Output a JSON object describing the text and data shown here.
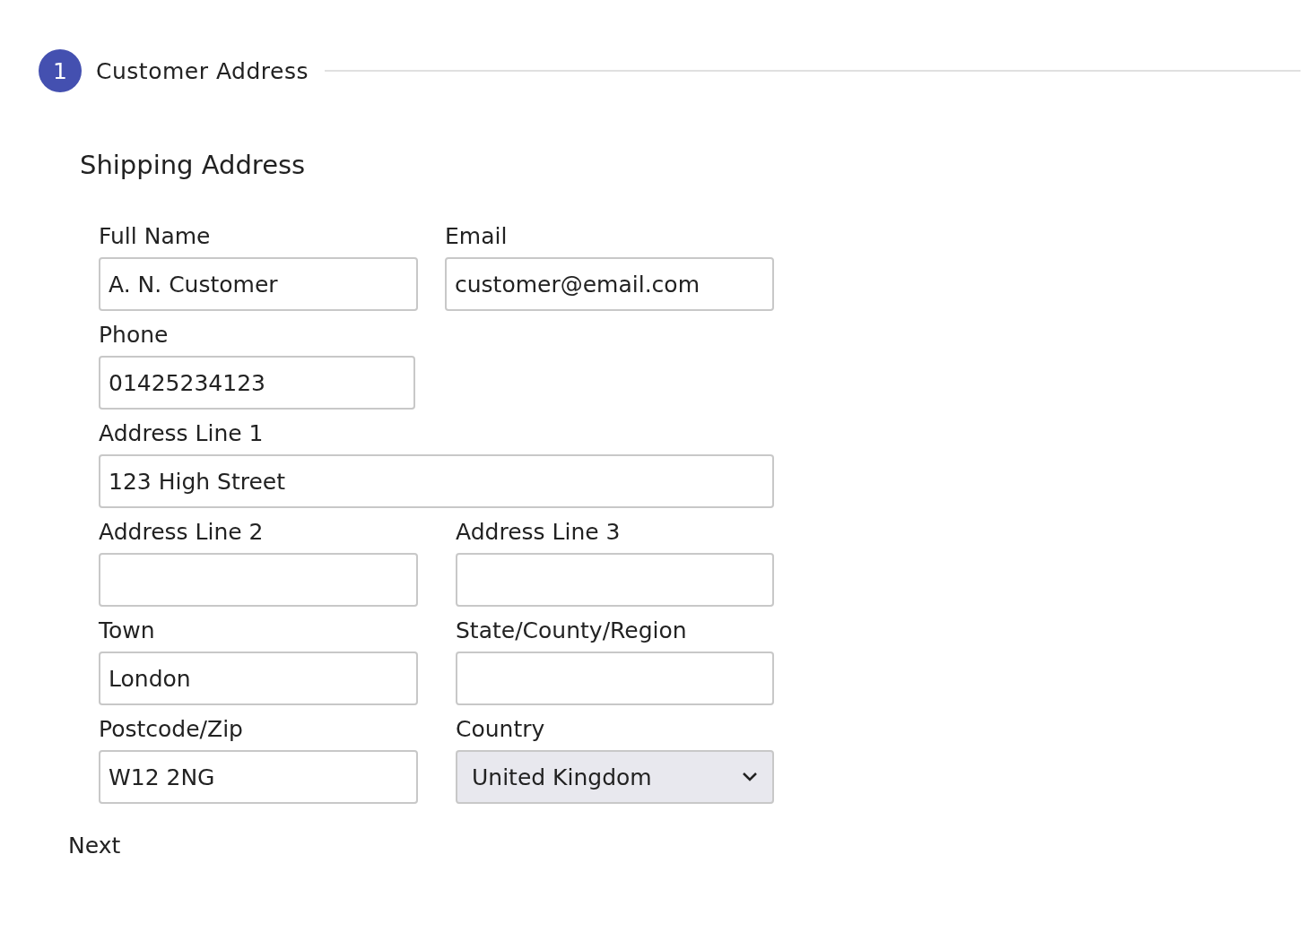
{
  "step": {
    "number": "1",
    "title": "Customer Address"
  },
  "section_title": "Shipping Address",
  "rows": [
    {
      "fields": [
        {
          "kind": "text",
          "label": "Full Name",
          "value": "A. N. Customer"
        },
        {
          "kind": "text",
          "label": "Email",
          "value": "customer@email.com"
        }
      ]
    },
    {
      "fields": [
        {
          "kind": "text",
          "label": "Phone",
          "value": "01425234123"
        }
      ]
    },
    {
      "fields": [
        {
          "kind": "text",
          "label": "Address Line 1",
          "value": "123 High Street"
        }
      ]
    },
    {
      "fields": [
        {
          "kind": "text",
          "label": "Address Line 2"
        },
        {
          "kind": "text",
          "label": "Address Line 3"
        }
      ]
    },
    {
      "fields": [
        {
          "kind": "text",
          "label": "Town",
          "value": "London"
        },
        {
          "kind": "text",
          "label": "State/County/Region"
        }
      ]
    },
    {
      "fields": [
        {
          "kind": "text",
          "label": "Postcode/Zip",
          "value": "W12 2NG"
        },
        {
          "kind": "select",
          "label": "Country",
          "value": "United Kingdom"
        }
      ]
    }
  ],
  "next_button": "Next"
}
